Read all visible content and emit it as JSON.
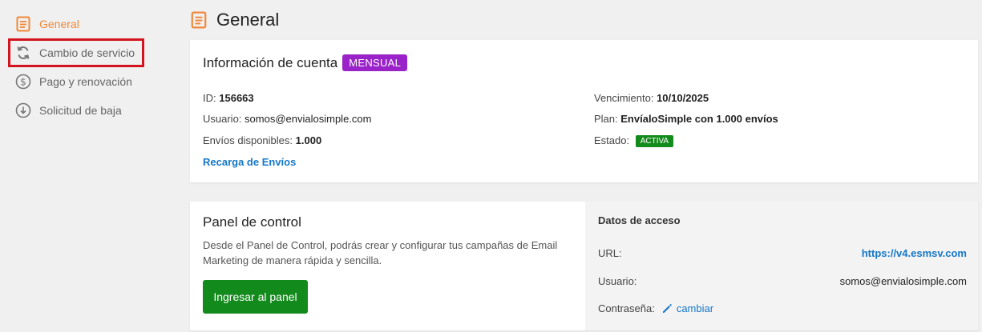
{
  "sidebar": {
    "items": [
      {
        "label": "General",
        "icon": "document-icon",
        "active": true
      },
      {
        "label": "Cambio de servicio",
        "icon": "refresh-icon",
        "highlighted": true
      },
      {
        "label": "Pago y renovación",
        "icon": "dollar-icon"
      },
      {
        "label": "Solicitud de baja",
        "icon": "download-circle-icon"
      }
    ]
  },
  "header": {
    "title": "General",
    "icon": "document-icon"
  },
  "account": {
    "title": "Información de cuenta",
    "plan_badge": "MENSUAL",
    "id_label": "ID:",
    "id_value": "156663",
    "user_label": "Usuario:",
    "user_value": "somos@envialosimple.com",
    "sends_label": "Envíos disponibles:",
    "sends_value": "1.000",
    "recharge_link": "Recarga de Envíos",
    "expiry_label": "Vencimiento:",
    "expiry_value": "10/10/2025",
    "plan_label": "Plan:",
    "plan_value": "EnvíaloSimple con 1.000 envíos",
    "status_label": "Estado:",
    "status_value": "ACTIVA"
  },
  "panel": {
    "title": "Panel de control",
    "description": "Desde el Panel de Control, podrás crear y configurar tus campañas de Email Marketing de manera rápida y sencilla.",
    "button": "Ingresar al panel"
  },
  "access": {
    "title": "Datos de acceso",
    "url_label": "URL:",
    "url_value": "https://v4.esmsv.com",
    "user_label": "Usuario:",
    "user_value": "somos@envialosimple.com",
    "password_label": "Contraseña:",
    "change_link": "cambiar"
  },
  "colors": {
    "accent_orange": "#f0883a",
    "purple_badge": "#9a22c9",
    "green": "#138a1c",
    "link_blue": "#1677c8",
    "highlight_red": "#d3131d"
  }
}
